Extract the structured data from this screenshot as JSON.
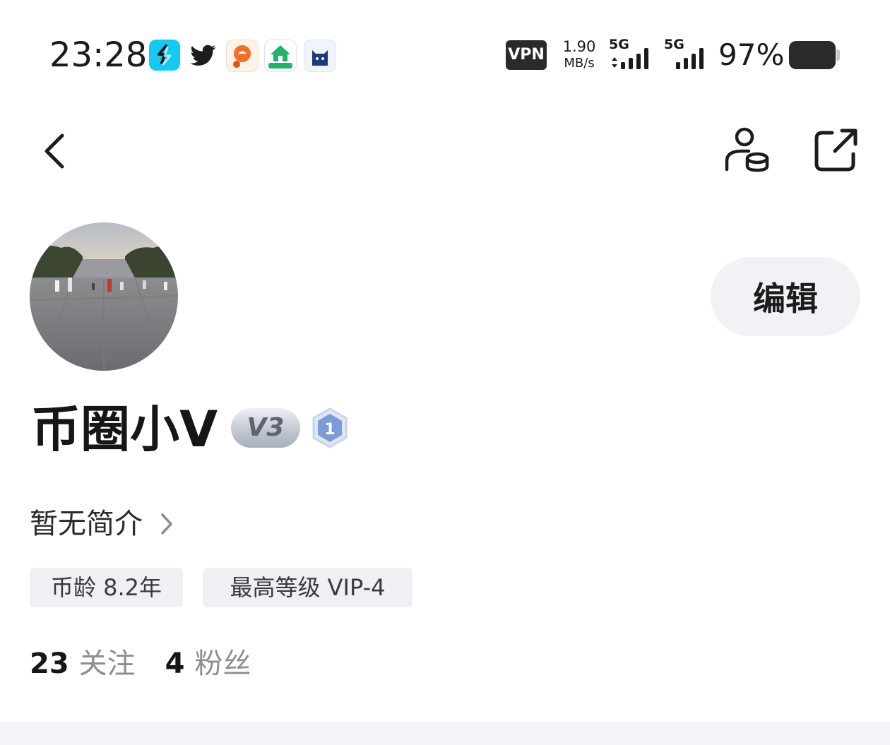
{
  "status_bar": {
    "time": "23:28",
    "app_icons": [
      "swap-app-icon",
      "twitter-icon",
      "food-pin-app-icon",
      "vr-home-app-icon",
      "cat-app-icon"
    ],
    "vpn_label": "VPN",
    "net_speed": "1.90",
    "net_speed_unit": "MB/s",
    "signal_1_label": "5G",
    "signal_2_label": "5G",
    "battery_percent": "97%"
  },
  "nav": {
    "back_icon": "chevron-left-icon",
    "user_settings_icon": "user-coin-icon",
    "share_icon": "external-share-icon"
  },
  "profile": {
    "nickname": "币圈小V",
    "vip_badge": "V3",
    "level_badge": "1",
    "edit_label": "编辑",
    "bio": "暂无简介",
    "tags": [
      "币龄 8.2年",
      "最高等级 VIP-4"
    ],
    "following_count": "23",
    "following_label": "关注",
    "followers_count": "4",
    "followers_label": "粉丝"
  },
  "colors": {
    "accent_cyan": "#16c9f0",
    "twitter": "#1d1d1d",
    "chip_background": "#eef0f4",
    "edit_button_background": "#f1f2f6",
    "level_badge_blue": "#7d9bd6"
  }
}
